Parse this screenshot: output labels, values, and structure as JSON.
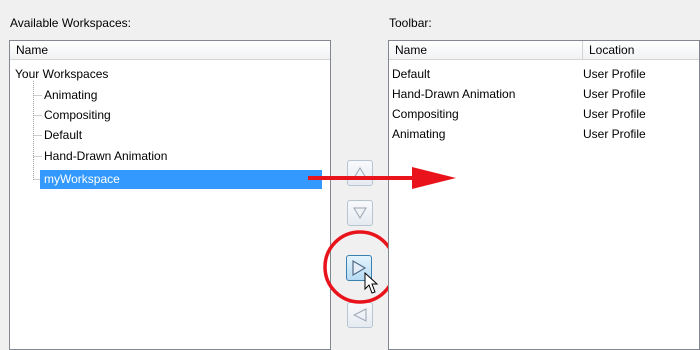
{
  "available": {
    "label": "Available Workspaces:",
    "column_header": "Name",
    "tree_root": "Your Workspaces",
    "items": [
      "Animating",
      "Compositing",
      "Default",
      "Hand-Drawn Animation",
      "myWorkspace"
    ],
    "selected_item": "myWorkspace"
  },
  "toolbar": {
    "label": "Toolbar:",
    "columns": [
      "Name",
      "Location"
    ],
    "rows": [
      {
        "name": "Default",
        "location": "User Profile"
      },
      {
        "name": "Hand-Drawn Animation",
        "location": "User Profile"
      },
      {
        "name": "Compositing",
        "location": "User Profile"
      },
      {
        "name": "Animating",
        "location": "User Profile"
      }
    ]
  },
  "buttons": {
    "move_up_icon": "triangle-up-icon",
    "move_down_icon": "triangle-down-icon",
    "add_icon": "triangle-right-icon",
    "remove_icon": "triangle-left-icon"
  },
  "annotation": {
    "color": "#e8131b"
  }
}
